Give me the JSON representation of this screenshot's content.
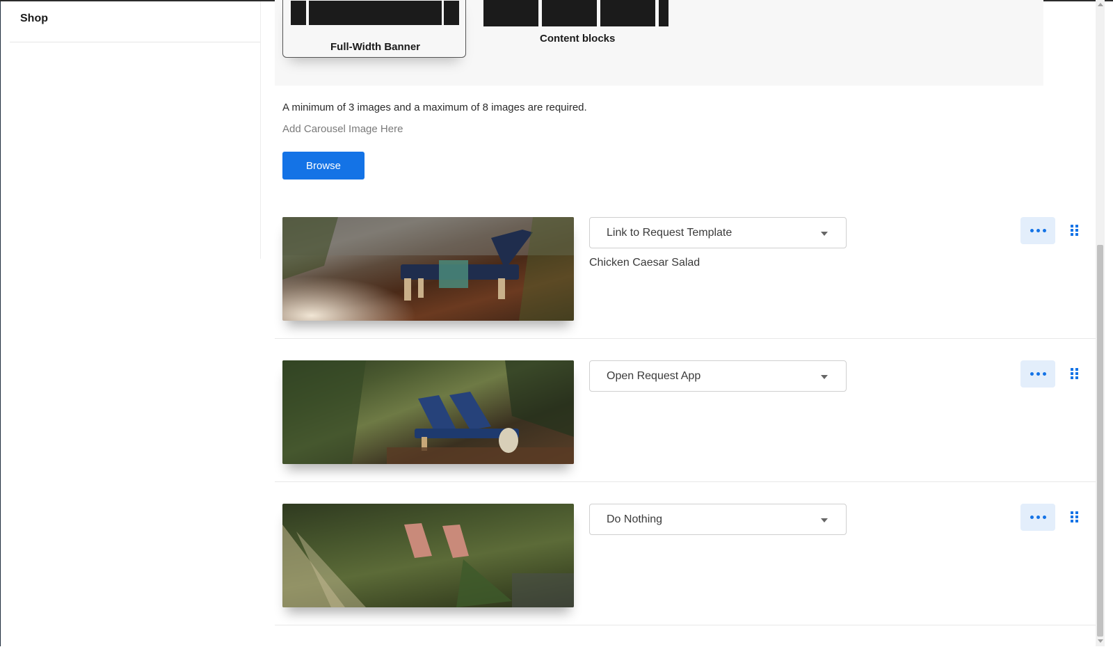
{
  "sidebar": {
    "title": "Shop"
  },
  "layouts": {
    "selected_label": "Full-Width Banner",
    "other_label": "Content blocks"
  },
  "carousel": {
    "requirement_text": "A minimum of 3 images and a maximum of 8 images are required.",
    "add_label": "Add Carousel Image Here",
    "browse_label": "Browse",
    "items": [
      {
        "action": "Link to Request Template",
        "detail": "Chicken Caesar Salad"
      },
      {
        "action": "Open Request App",
        "detail": ""
      },
      {
        "action": "Do Nothing",
        "detail": ""
      }
    ]
  },
  "colors": {
    "accent": "#1473e6",
    "accent_light": "#e3eefb"
  }
}
